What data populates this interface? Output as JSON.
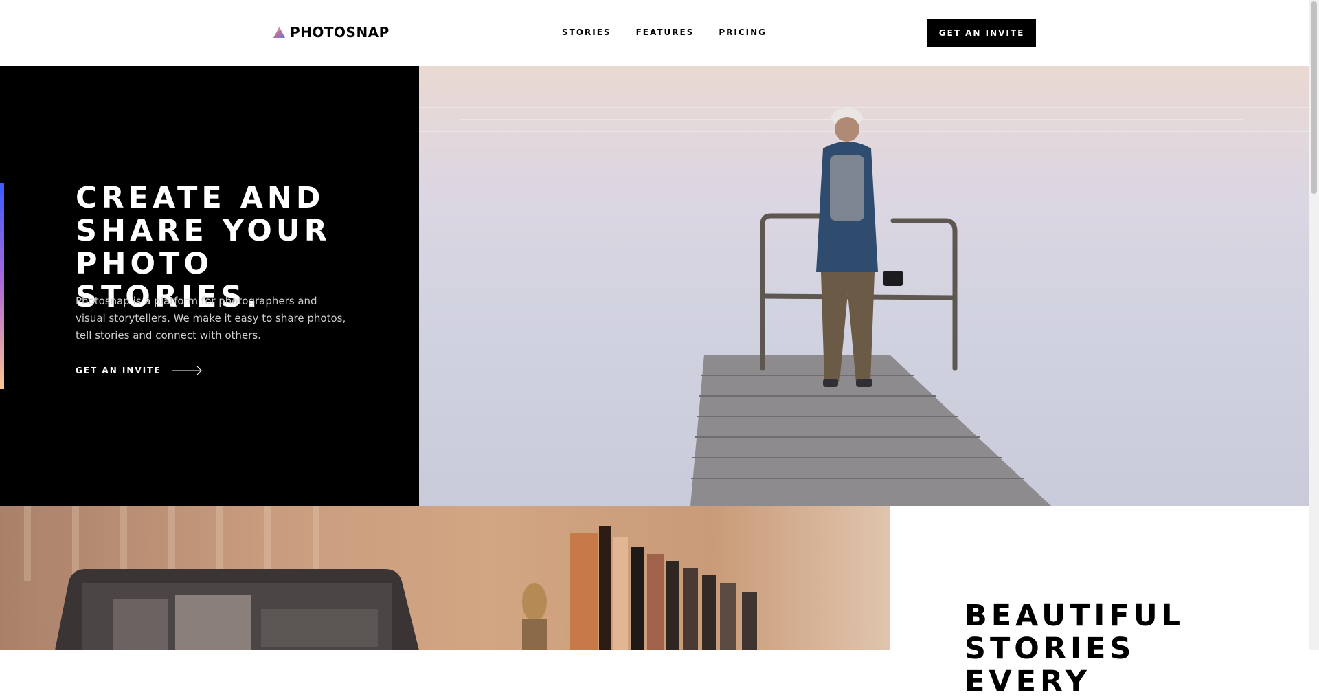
{
  "brand": {
    "name": "PHOTOSNAP"
  },
  "nav": {
    "items": [
      {
        "label": "STORIES"
      },
      {
        "label": "FEATURES"
      },
      {
        "label": "PRICING"
      }
    ],
    "cta_label": "GET AN INVITE"
  },
  "hero": {
    "title": "CREATE AND SHARE YOUR PHOTO STORIES.",
    "text": "Photosnap is a platform for photographers and visual storytellers. We make it easy to share photos, tell stories and connect with others.",
    "cta_label": "GET AN INVITE",
    "accent_colors": [
      "#3b5bff",
      "#b06bd6",
      "#ffc593"
    ]
  },
  "feature": {
    "title": "BEAUTIFUL STORIES EVERY"
  },
  "icons": [
    "logo-triangle-icon",
    "arrow-right-icon"
  ]
}
